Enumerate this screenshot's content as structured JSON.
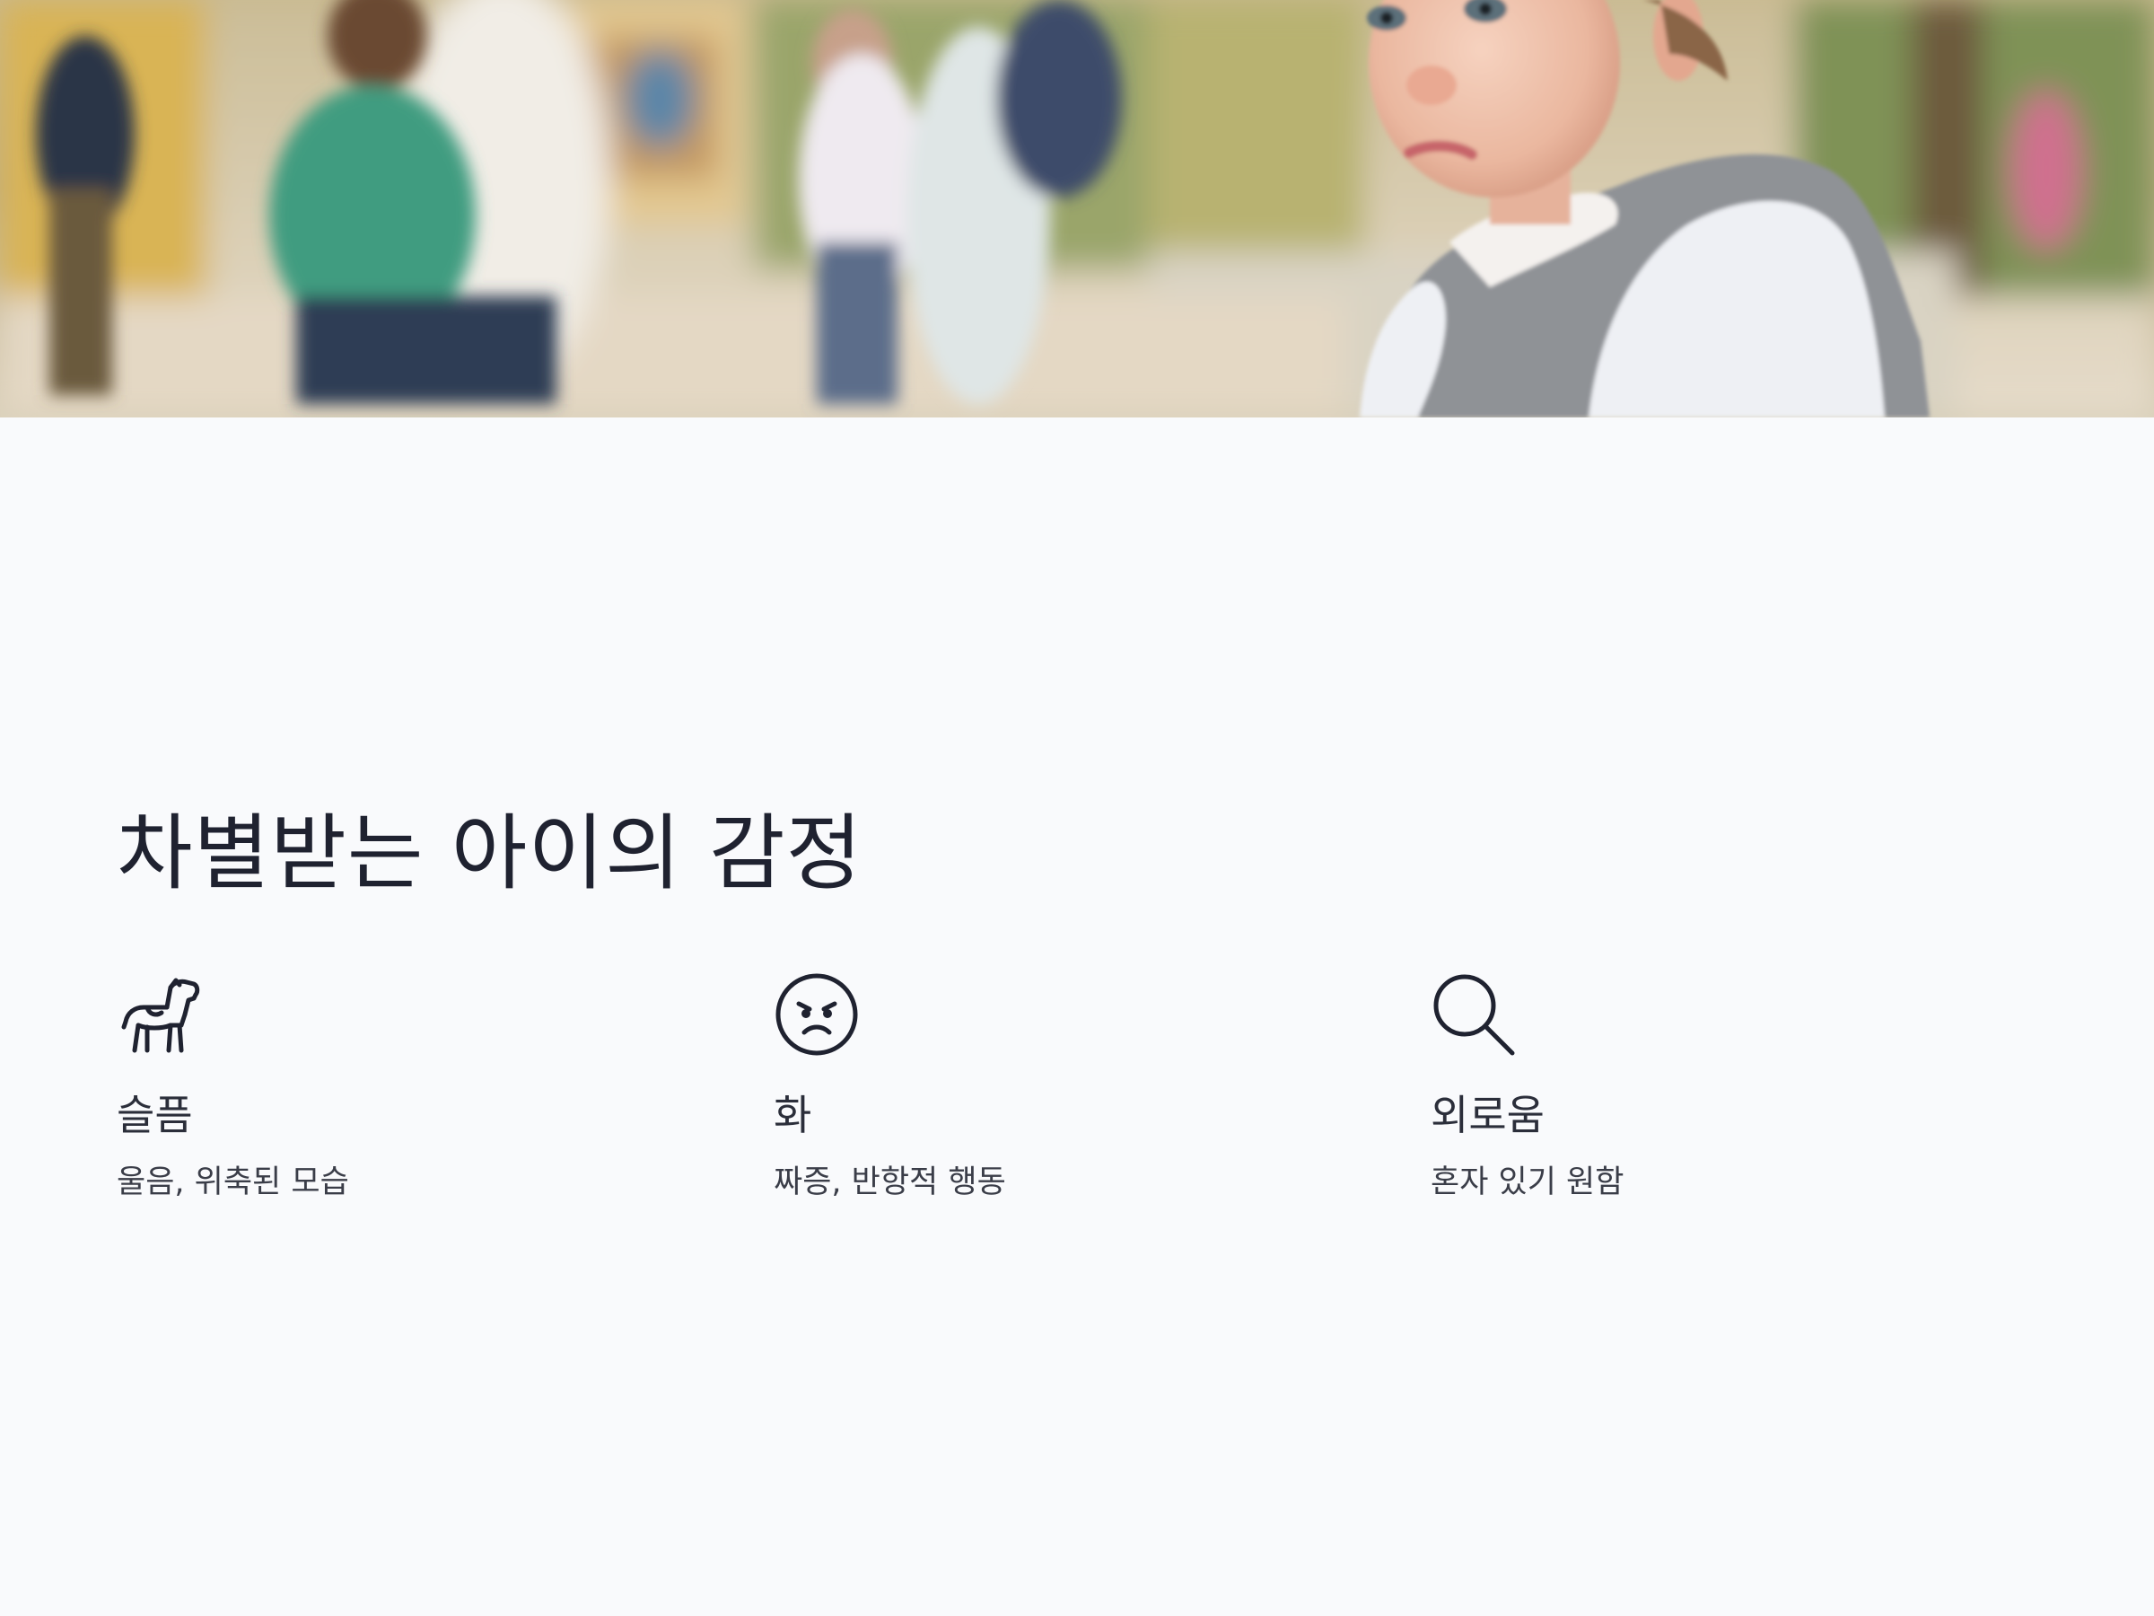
{
  "hero": {
    "image": "blurred playground with a sad toddler in a grey knit vest in the foreground"
  },
  "section": {
    "title": "차별받는 아이의 감정"
  },
  "emotions": [
    {
      "icon": "horse-icon",
      "label": "슬픔",
      "description": "울음, 위축된 모습"
    },
    {
      "icon": "angry-face-icon",
      "label": "화",
      "description": "짜증, 반항적 행동"
    },
    {
      "icon": "search-icon",
      "label": "외로움",
      "description": "혼자 있기 원함"
    }
  ],
  "colors": {
    "background": "#f9fafc",
    "title_text": "#1f2230",
    "icon_stroke": "#1f2230"
  }
}
